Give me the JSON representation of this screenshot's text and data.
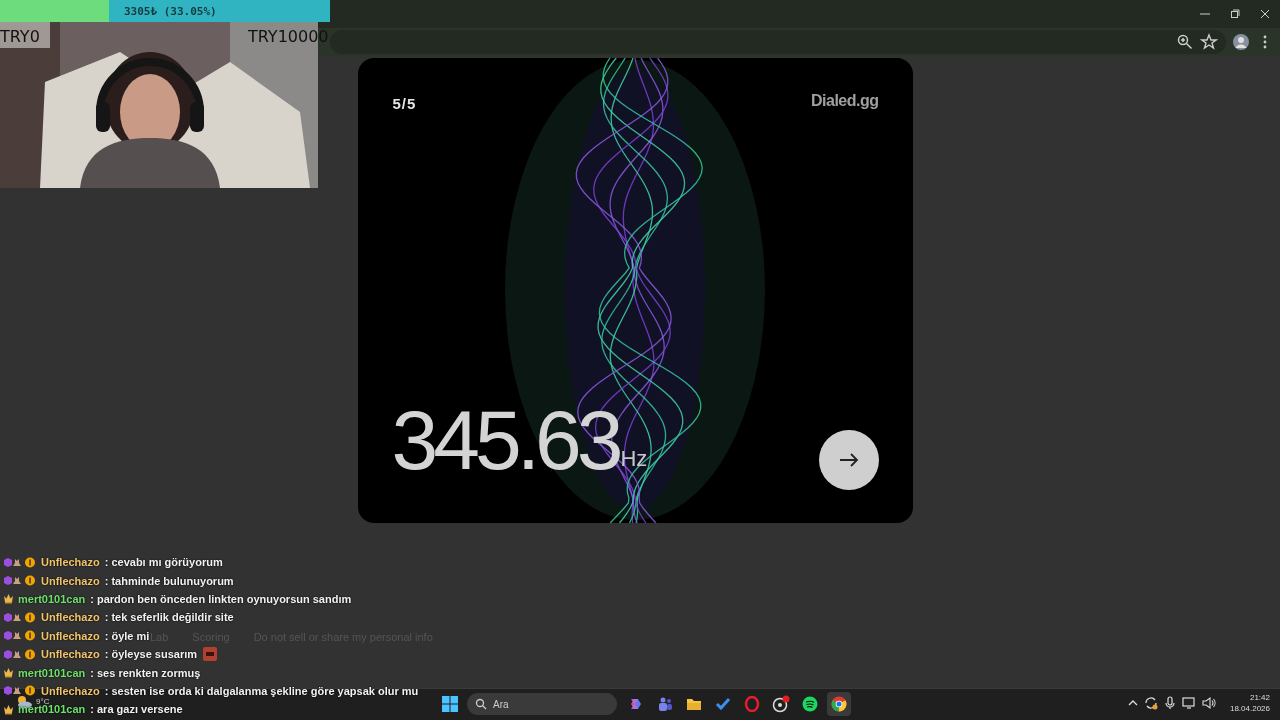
{
  "card": {
    "counter": "5/5",
    "brand": "Dialed.gg",
    "value": "345.63",
    "unit": "Hz"
  },
  "footer": {
    "links": [
      "Lab",
      "Scoring",
      "Do not sell or share my personal info"
    ]
  },
  "stream_overlay": {
    "goal": {
      "text": "3305₺ (33.05%)",
      "level": 0.3305,
      "min_label": "TRY0",
      "max_label": "TRY10000"
    }
  },
  "chat": [
    {
      "kind": "subscriber",
      "user": "Unflechazo",
      "color": "#f2c46a",
      "text": ": cevabı mı görüyorum"
    },
    {
      "kind": "subscriber",
      "user": "Unflechazo",
      "color": "#f2c46a",
      "text": ": tahminde bulunuyorum"
    },
    {
      "kind": "vip",
      "user": "mert0101can",
      "color": "#6ee06a",
      "text": ": pardon ben önceden linkten oynuyorsun sandım"
    },
    {
      "kind": "subscriber",
      "user": "Unflechazo",
      "color": "#f2c46a",
      "text": ": tek seferlik değildir site"
    },
    {
      "kind": "subscriber",
      "user": "Unflechazo",
      "color": "#f2c46a",
      "text": ": öyle mi"
    },
    {
      "kind": "subscriber",
      "user": "Unflechazo",
      "color": "#f2c46a",
      "text": ": öyleyse susarım",
      "emote": true
    },
    {
      "kind": "vip",
      "user": "mert0101can",
      "color": "#6ee06a",
      "text": ": ses renkten zormuş"
    },
    {
      "kind": "subscriber",
      "user": "Unflechazo",
      "color": "#f2c46a",
      "text": ": sesten ise orda ki dalgalanma şekline göre yapsak olur mu"
    },
    {
      "kind": "vip",
      "user": "mert0101can",
      "color": "#6ee06a",
      "text": ": ara gazı versene"
    }
  ],
  "taskbar": {
    "weather": "9°C",
    "search": {
      "placeholder": "Ara"
    },
    "apps": [
      {
        "kind": "copilot",
        "selected": false
      },
      {
        "kind": "teams",
        "selected": false
      },
      {
        "kind": "folder",
        "selected": false
      },
      {
        "kind": "todo",
        "selected": false
      },
      {
        "kind": "opera",
        "selected": false
      },
      {
        "kind": "obs",
        "selected": false
      },
      {
        "kind": "spotify",
        "selected": false
      },
      {
        "kind": "chrome",
        "selected": true
      }
    ],
    "time": "21:42",
    "date": "18.04.2026"
  }
}
